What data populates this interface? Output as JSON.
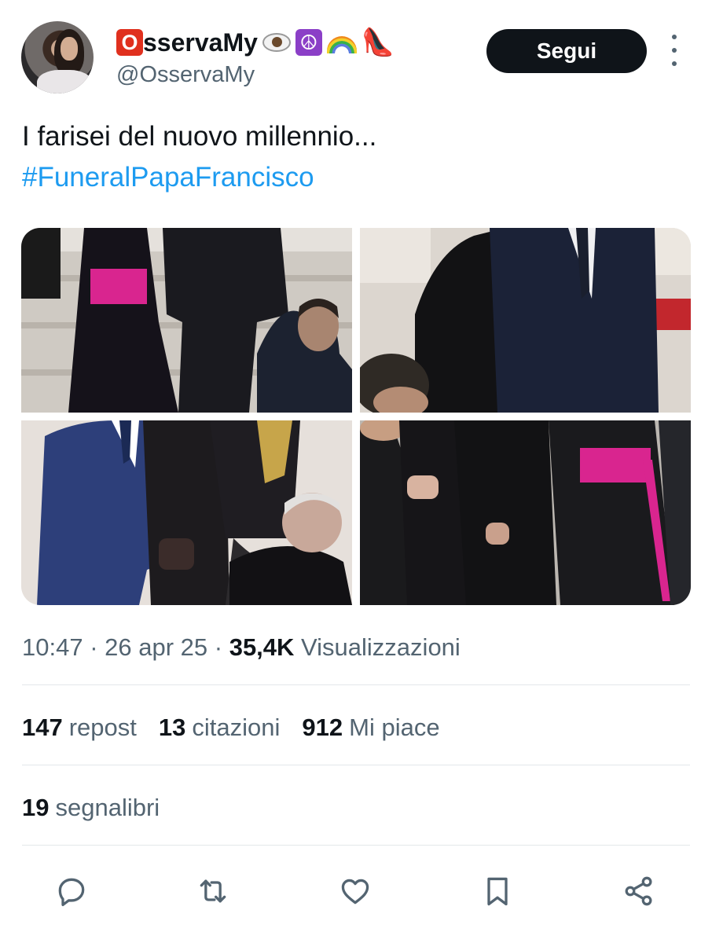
{
  "author": {
    "name": "OsservaMy",
    "name_initial": "O",
    "handle": "@OsservaMy",
    "emoji_icons": [
      "eye-icon",
      "peace-icon",
      "rainbow-icon",
      "high-heel-icon"
    ]
  },
  "follow_label": "Segui",
  "tweet": {
    "text": "I farisei del nuovo millennio...",
    "hashtag": "#FuneralPapaFrancisco"
  },
  "meta": {
    "time": "10:47",
    "sep1": " · ",
    "date": "26 apr 25",
    "sep2": " · ",
    "views_count": "35,4K",
    "views_label": " Visualizzazioni"
  },
  "stats": {
    "reposts_count": "147",
    "reposts_label": "repost",
    "quotes_count": "13",
    "quotes_label": "citazioni",
    "likes_count": "912",
    "likes_label": "Mi piace",
    "bookmarks_count": "19",
    "bookmarks_label": "segnalibri"
  },
  "actions": [
    "reply-icon",
    "repost-icon",
    "like-icon",
    "bookmark-icon",
    "share-icon"
  ],
  "colors": {
    "text_primary": "#0f1419",
    "text_secondary": "#536471",
    "link": "#1d9bf0",
    "button_bg": "#0f1419",
    "divider": "#e3e7ea",
    "sash_magenta": "#d9258f"
  }
}
